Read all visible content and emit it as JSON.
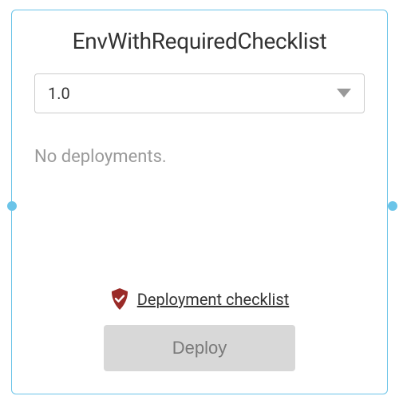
{
  "card": {
    "title": "EnvWithRequiredChecklist",
    "version_select": {
      "value": "1.0"
    },
    "status": "No deployments.",
    "checklist_link": "Deployment checklist",
    "deploy_button": "Deploy"
  }
}
